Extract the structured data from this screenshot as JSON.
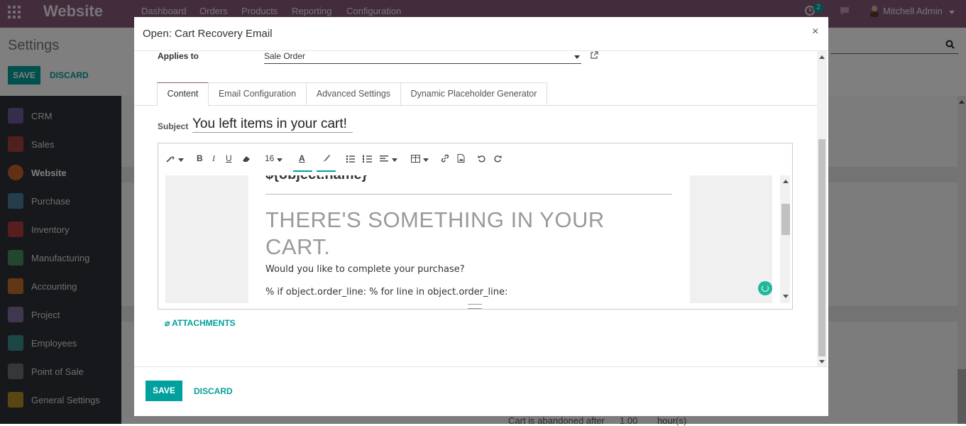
{
  "app": {
    "brand": "Website",
    "menu": [
      "Dashboard",
      "Orders",
      "Products",
      "Reporting",
      "Configuration"
    ],
    "activity_count": "2",
    "user": "Mitchell Admin"
  },
  "settings": {
    "title": "Settings",
    "save_label": "SAVE",
    "discard_label": "DISCARD"
  },
  "sidebar": {
    "items": [
      {
        "label": "CRM",
        "color": "#6b5b95"
      },
      {
        "label": "Sales",
        "color": "#a53f3f"
      },
      {
        "label": "Website",
        "color": "#c8602b"
      },
      {
        "label": "Purchase",
        "color": "#4a7a9b"
      },
      {
        "label": "Inventory",
        "color": "#b03a3a"
      },
      {
        "label": "Manufacturing",
        "color": "#4a8c5c"
      },
      {
        "label": "Accounting",
        "color": "#c0712a"
      },
      {
        "label": "Project",
        "color": "#7c6ea0"
      },
      {
        "label": "Employees",
        "color": "#3a8c8c"
      },
      {
        "label": "Point of Sale",
        "color": "#6e6e6e"
      },
      {
        "label": "General Settings",
        "color": "#b58a2a"
      }
    ]
  },
  "background_fields": {
    "abandoned_label": "Cart is abandoned after",
    "abandoned_value": "1.00",
    "abandoned_unit": "hour(s)"
  },
  "modal": {
    "title": "Open: Cart Recovery Email",
    "applies_to_label": "Applies to",
    "applies_to_value": "Sale Order",
    "tabs": [
      "Content",
      "Email Configuration",
      "Advanced Settings",
      "Dynamic Placeholder Generator"
    ],
    "subject_label": "Subject",
    "subject_value": "You left items in your cart!",
    "toolbar": {
      "font_size": "16"
    },
    "editor": {
      "object_name": "${object.name}",
      "heading": "THERE'S SOMETHING IN YOUR CART.",
      "line1": "Would you like to complete your purchase?",
      "line2": "% if object.order_line: % for line in object.order_line:"
    },
    "attachments_label": "ATTACHMENTS",
    "save_label": "SAVE",
    "discard_label": "DISCARD"
  },
  "colors": {
    "brand": "#875a7b",
    "accent": "#00a09d"
  }
}
